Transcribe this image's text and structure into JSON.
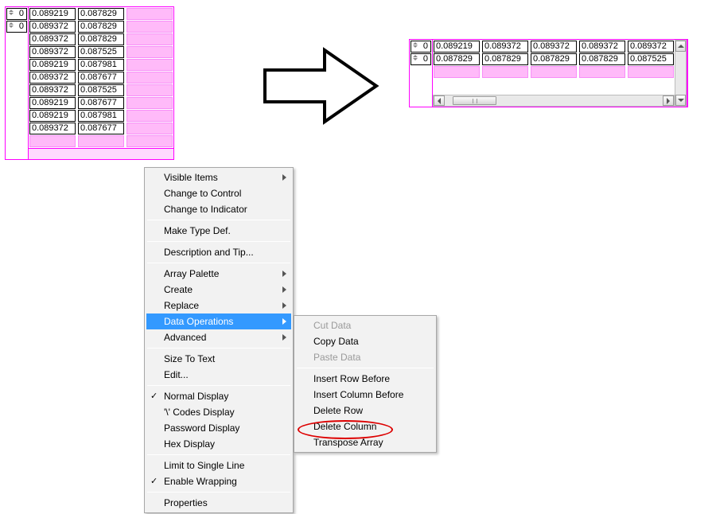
{
  "left_array": {
    "index_values": [
      "0",
      "0"
    ],
    "rows": [
      [
        "0.089219",
        "0.087829",
        ""
      ],
      [
        "0.089372",
        "0.087829",
        ""
      ],
      [
        "0.089372",
        "0.087829",
        ""
      ],
      [
        "0.089372",
        "0.087525",
        ""
      ],
      [
        "0.089219",
        "0.087981",
        ""
      ],
      [
        "0.089372",
        "0.087677",
        ""
      ],
      [
        "0.089372",
        "0.087525",
        ""
      ],
      [
        "0.089219",
        "0.087677",
        ""
      ],
      [
        "0.089219",
        "0.087981",
        ""
      ],
      [
        "0.089372",
        "0.087677",
        ""
      ]
    ]
  },
  "right_array": {
    "index_values": [
      "0",
      "0"
    ],
    "rows": [
      [
        "0.089219",
        "0.089372",
        "0.089372",
        "0.089372",
        "0.089372"
      ],
      [
        "0.087829",
        "0.087829",
        "0.087829",
        "0.087829",
        "0.087525"
      ]
    ]
  },
  "ctx_main": {
    "groups": [
      [
        {
          "label": "Visible Items",
          "sub": true
        },
        {
          "label": "Change to Control"
        },
        {
          "label": "Change to Indicator"
        }
      ],
      [
        {
          "label": "Make Type Def."
        }
      ],
      [
        {
          "label": "Description and Tip..."
        }
      ],
      [
        {
          "label": "Array Palette",
          "sub": true
        },
        {
          "label": "Create",
          "sub": true
        },
        {
          "label": "Replace",
          "sub": true
        },
        {
          "label": "Data Operations",
          "sub": true,
          "hl": true
        },
        {
          "label": "Advanced",
          "sub": true
        }
      ],
      [
        {
          "label": "Size To Text"
        },
        {
          "label": "Edit..."
        }
      ],
      [
        {
          "label": "Normal Display",
          "check": true
        },
        {
          "label": "'\\' Codes Display"
        },
        {
          "label": "Password Display"
        },
        {
          "label": "Hex Display"
        }
      ],
      [
        {
          "label": "Limit to Single Line"
        },
        {
          "label": "Enable Wrapping",
          "check": true
        }
      ],
      [
        {
          "label": "Properties"
        }
      ]
    ]
  },
  "ctx_sub": {
    "groups": [
      [
        {
          "label": "Cut Data",
          "disabled": true
        },
        {
          "label": "Copy Data"
        },
        {
          "label": "Paste Data",
          "disabled": true
        }
      ],
      [
        {
          "label": "Insert Row Before"
        },
        {
          "label": "Insert Column Before"
        },
        {
          "label": "Delete Row"
        },
        {
          "label": "Delete Column"
        },
        {
          "label": "Transpose Array"
        }
      ]
    ]
  },
  "labels": {
    "scrollbar_grip": "III"
  }
}
